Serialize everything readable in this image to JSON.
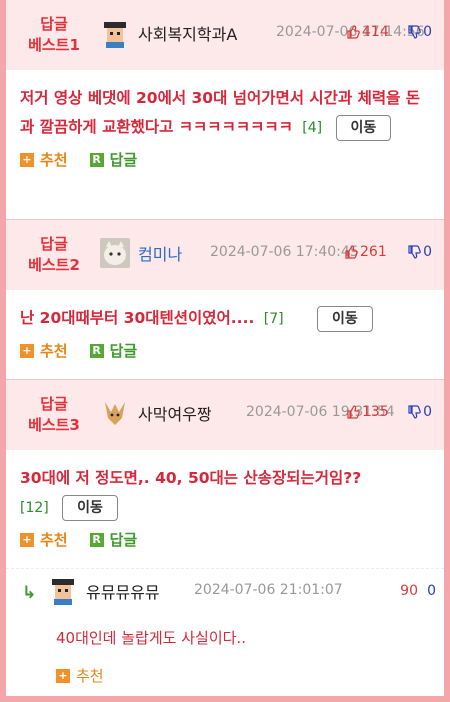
{
  "comments": [
    {
      "badge_line1": "답글",
      "badge_line2": "베스트1",
      "nickname": "사회복지학과A",
      "date": "2024-07-06 17:14:56",
      "upvotes": "414",
      "downvotes": "0",
      "text": "저거 영상 베댓에 20에서 30대 넘어가면서 시간과 체력을 돈과 깔끔하게 교환했다고 ㅋㅋㅋㅋㅋㅋㅋㅋ",
      "reply_count": "[4]",
      "move_label": "이동",
      "recommend_label": "추천",
      "reply_label": "답글"
    },
    {
      "badge_line1": "답글",
      "badge_line2": "베스트2",
      "nickname": "컴미나",
      "date": "2024-07-06 17:40:45",
      "upvotes": "261",
      "downvotes": "0",
      "text": "난 20대때부터 30대텐션이였어....",
      "reply_count": "[7]",
      "move_label": "이동",
      "recommend_label": "추천",
      "reply_label": "답글"
    },
    {
      "badge_line1": "답글",
      "badge_line2": "베스트3",
      "nickname": "사막여우짱",
      "date": "2024-07-06 19:31:54",
      "upvotes": "135",
      "downvotes": "0",
      "text": "30대에 저 정도면,. 40, 50대는 산송장되는거임??",
      "reply_count": "[12]",
      "move_label": "이동",
      "recommend_label": "추천",
      "reply_label": "답글"
    }
  ],
  "reply": {
    "nickname": "유뮤뮤유뮤",
    "date": "2024-07-06 21:01:07",
    "upvotes": "90",
    "downvotes": "0",
    "text": "40대인데 놀랍게도 사실이다..",
    "recommend_label": "추천"
  }
}
